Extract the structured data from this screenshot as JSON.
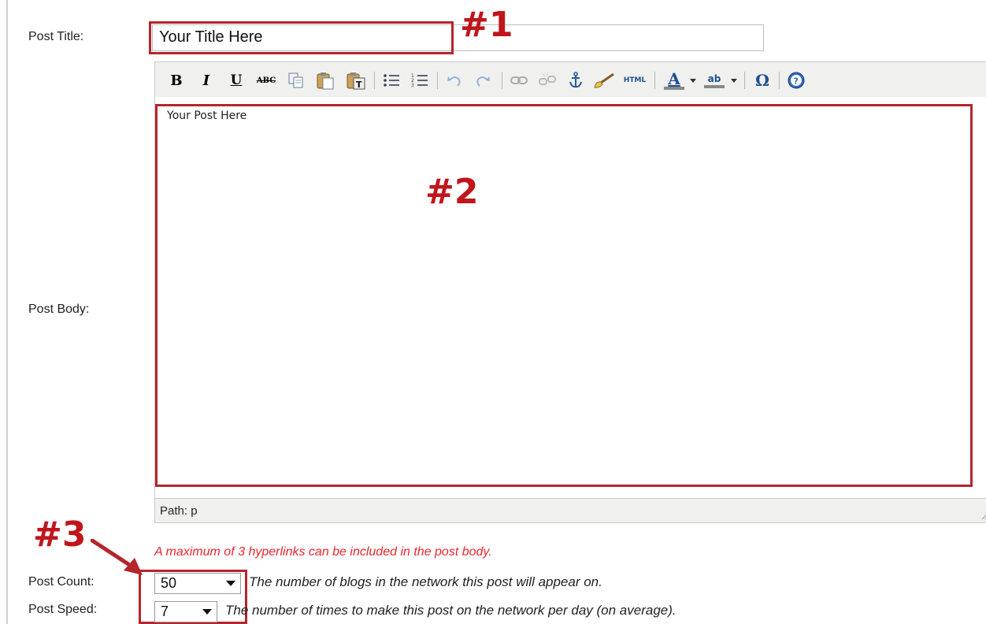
{
  "labels": {
    "post_title": "Post Title:",
    "post_body": "Post Body:",
    "post_count": "Post Count:",
    "post_speed": "Post Speed:"
  },
  "title_input": {
    "value": "Your Title Here"
  },
  "editor": {
    "body_text": "Your Post Here",
    "path": "Path: p",
    "toolbar": {
      "bold": "B",
      "italic": "I",
      "underline": "U",
      "strikethrough": "ABC",
      "html": "HTML",
      "font_color": "A",
      "highlight": "ab",
      "special_char": "Ω"
    }
  },
  "annotations": {
    "one": "#1",
    "two": "#2",
    "three": "#3"
  },
  "warning": "A maximum of 3 hyperlinks can be included in the post body.",
  "post_count": {
    "value": "50",
    "description": "The number of blogs in the network this post will appear on."
  },
  "post_speed": {
    "value": "7",
    "description": "The number of times to make this post on the network per day (on average)."
  },
  "colors": {
    "annotation_red": "#b3262b",
    "warning_red": "#e8262d",
    "toolbar_bg": "#f0f0ee"
  }
}
